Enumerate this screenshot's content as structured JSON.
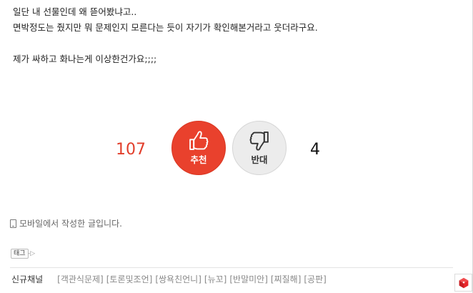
{
  "post": {
    "lines": [
      "일단 내 선물인데 왜 뜯어봤냐고..",
      "면박정도는 줬지만 뭐 문제인지 모른다는 듯이 자기가 확인해본거라고 웃더라구요.",
      "제가 싸하고 화나는게 이상한건가요;;;;"
    ]
  },
  "vote": {
    "up_count": "107",
    "up_label": "추천",
    "down_label": "반대",
    "down_count": "4",
    "up_color": "#e9412d",
    "down_color": "#ececec",
    "up_count_color": "#e23e2b",
    "up_icon": "thumbs-up-icon",
    "down_icon": "thumbs-down-icon"
  },
  "mobile_note": {
    "icon": "phone-icon",
    "text": "모바일에서 작성한 글입니다."
  },
  "tags": {
    "label": "태그",
    "arrow": "-▷"
  },
  "channels": {
    "title": "신규채널",
    "items": [
      "[객관식문제]",
      "[토론및조언]",
      "[쌍욕친언니]",
      "[뉴꼬]",
      "[반말미안]",
      "[찌질해]",
      "[공판]"
    ]
  },
  "corner": {
    "icon": "red-cube-icon",
    "color": "#e8262a"
  }
}
